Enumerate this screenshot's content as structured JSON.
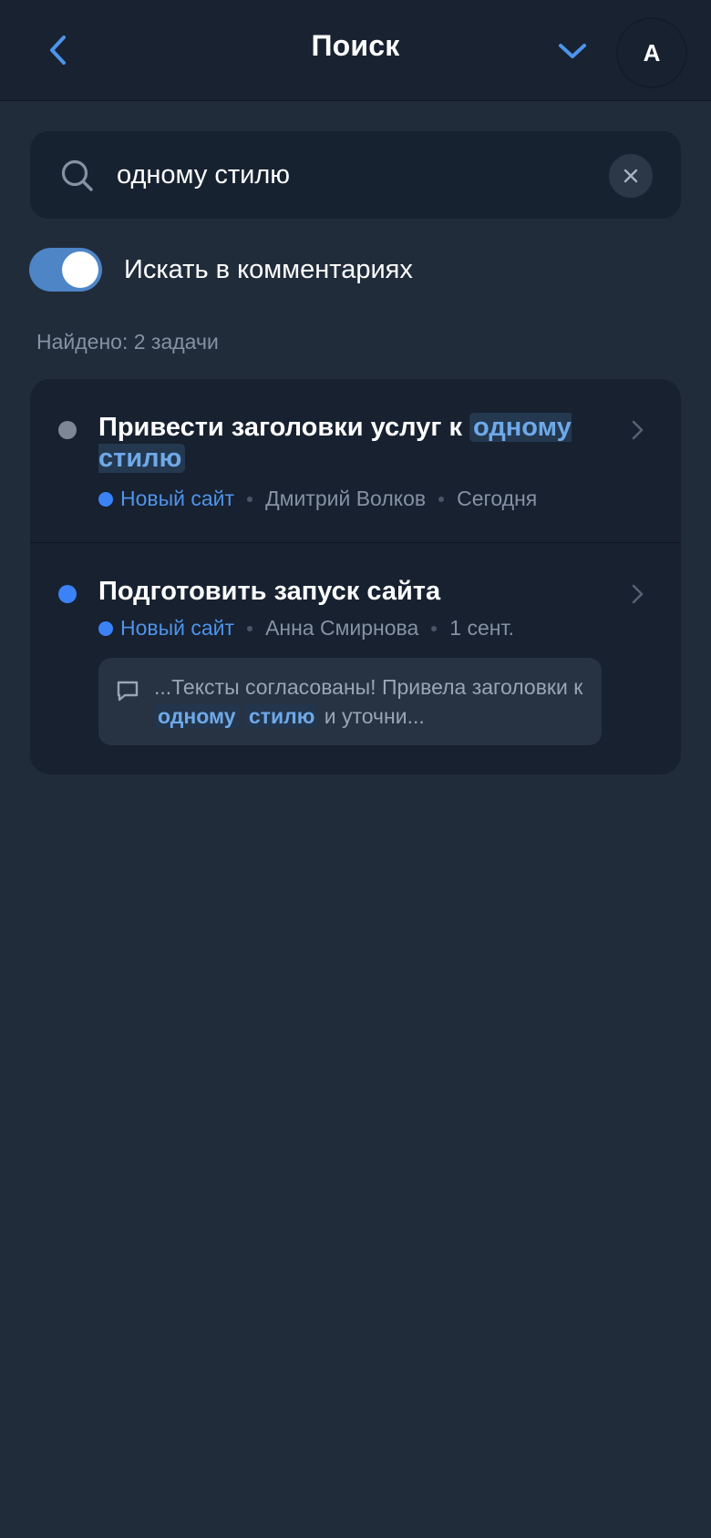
{
  "header": {
    "back_icon": "chevron-left-icon",
    "title": "Поиск",
    "menu_icon": "chevron-down-icon",
    "avatar_initial": "А"
  },
  "search": {
    "icon": "search-icon",
    "value": "одному стилю",
    "clear_icon": "close-icon"
  },
  "comments_toggle": {
    "enabled": true,
    "label": "Искать в комментариях"
  },
  "results": {
    "count_label": "Найдено: 2 задачи",
    "tasks": [
      {
        "title_prefix": "Привести заголовки услуг к ",
        "title_highlight": "одному стилю",
        "status_color": "#7d8795",
        "project": "Новый сайт",
        "assignee": "Дмитрий Волков",
        "date": "Сегодня"
      },
      {
        "title": "Подготовить запуск сайта",
        "status_color": "#3b82f6",
        "project": "Новый сайт",
        "assignee": "Анна Смирнова",
        "date": "1 сент.",
        "comment": {
          "icon": "comment-icon",
          "text_before": "...Тексты согласованы! Привела заголовки к ",
          "highlight_1": "одному",
          "highlight_2": "стилю",
          "text_after": " и уточни..."
        }
      }
    ]
  },
  "colors": {
    "background": "#212c3b",
    "surface": "#172130",
    "accent": "#4f93ea",
    "highlight_bg": "#24384f"
  }
}
